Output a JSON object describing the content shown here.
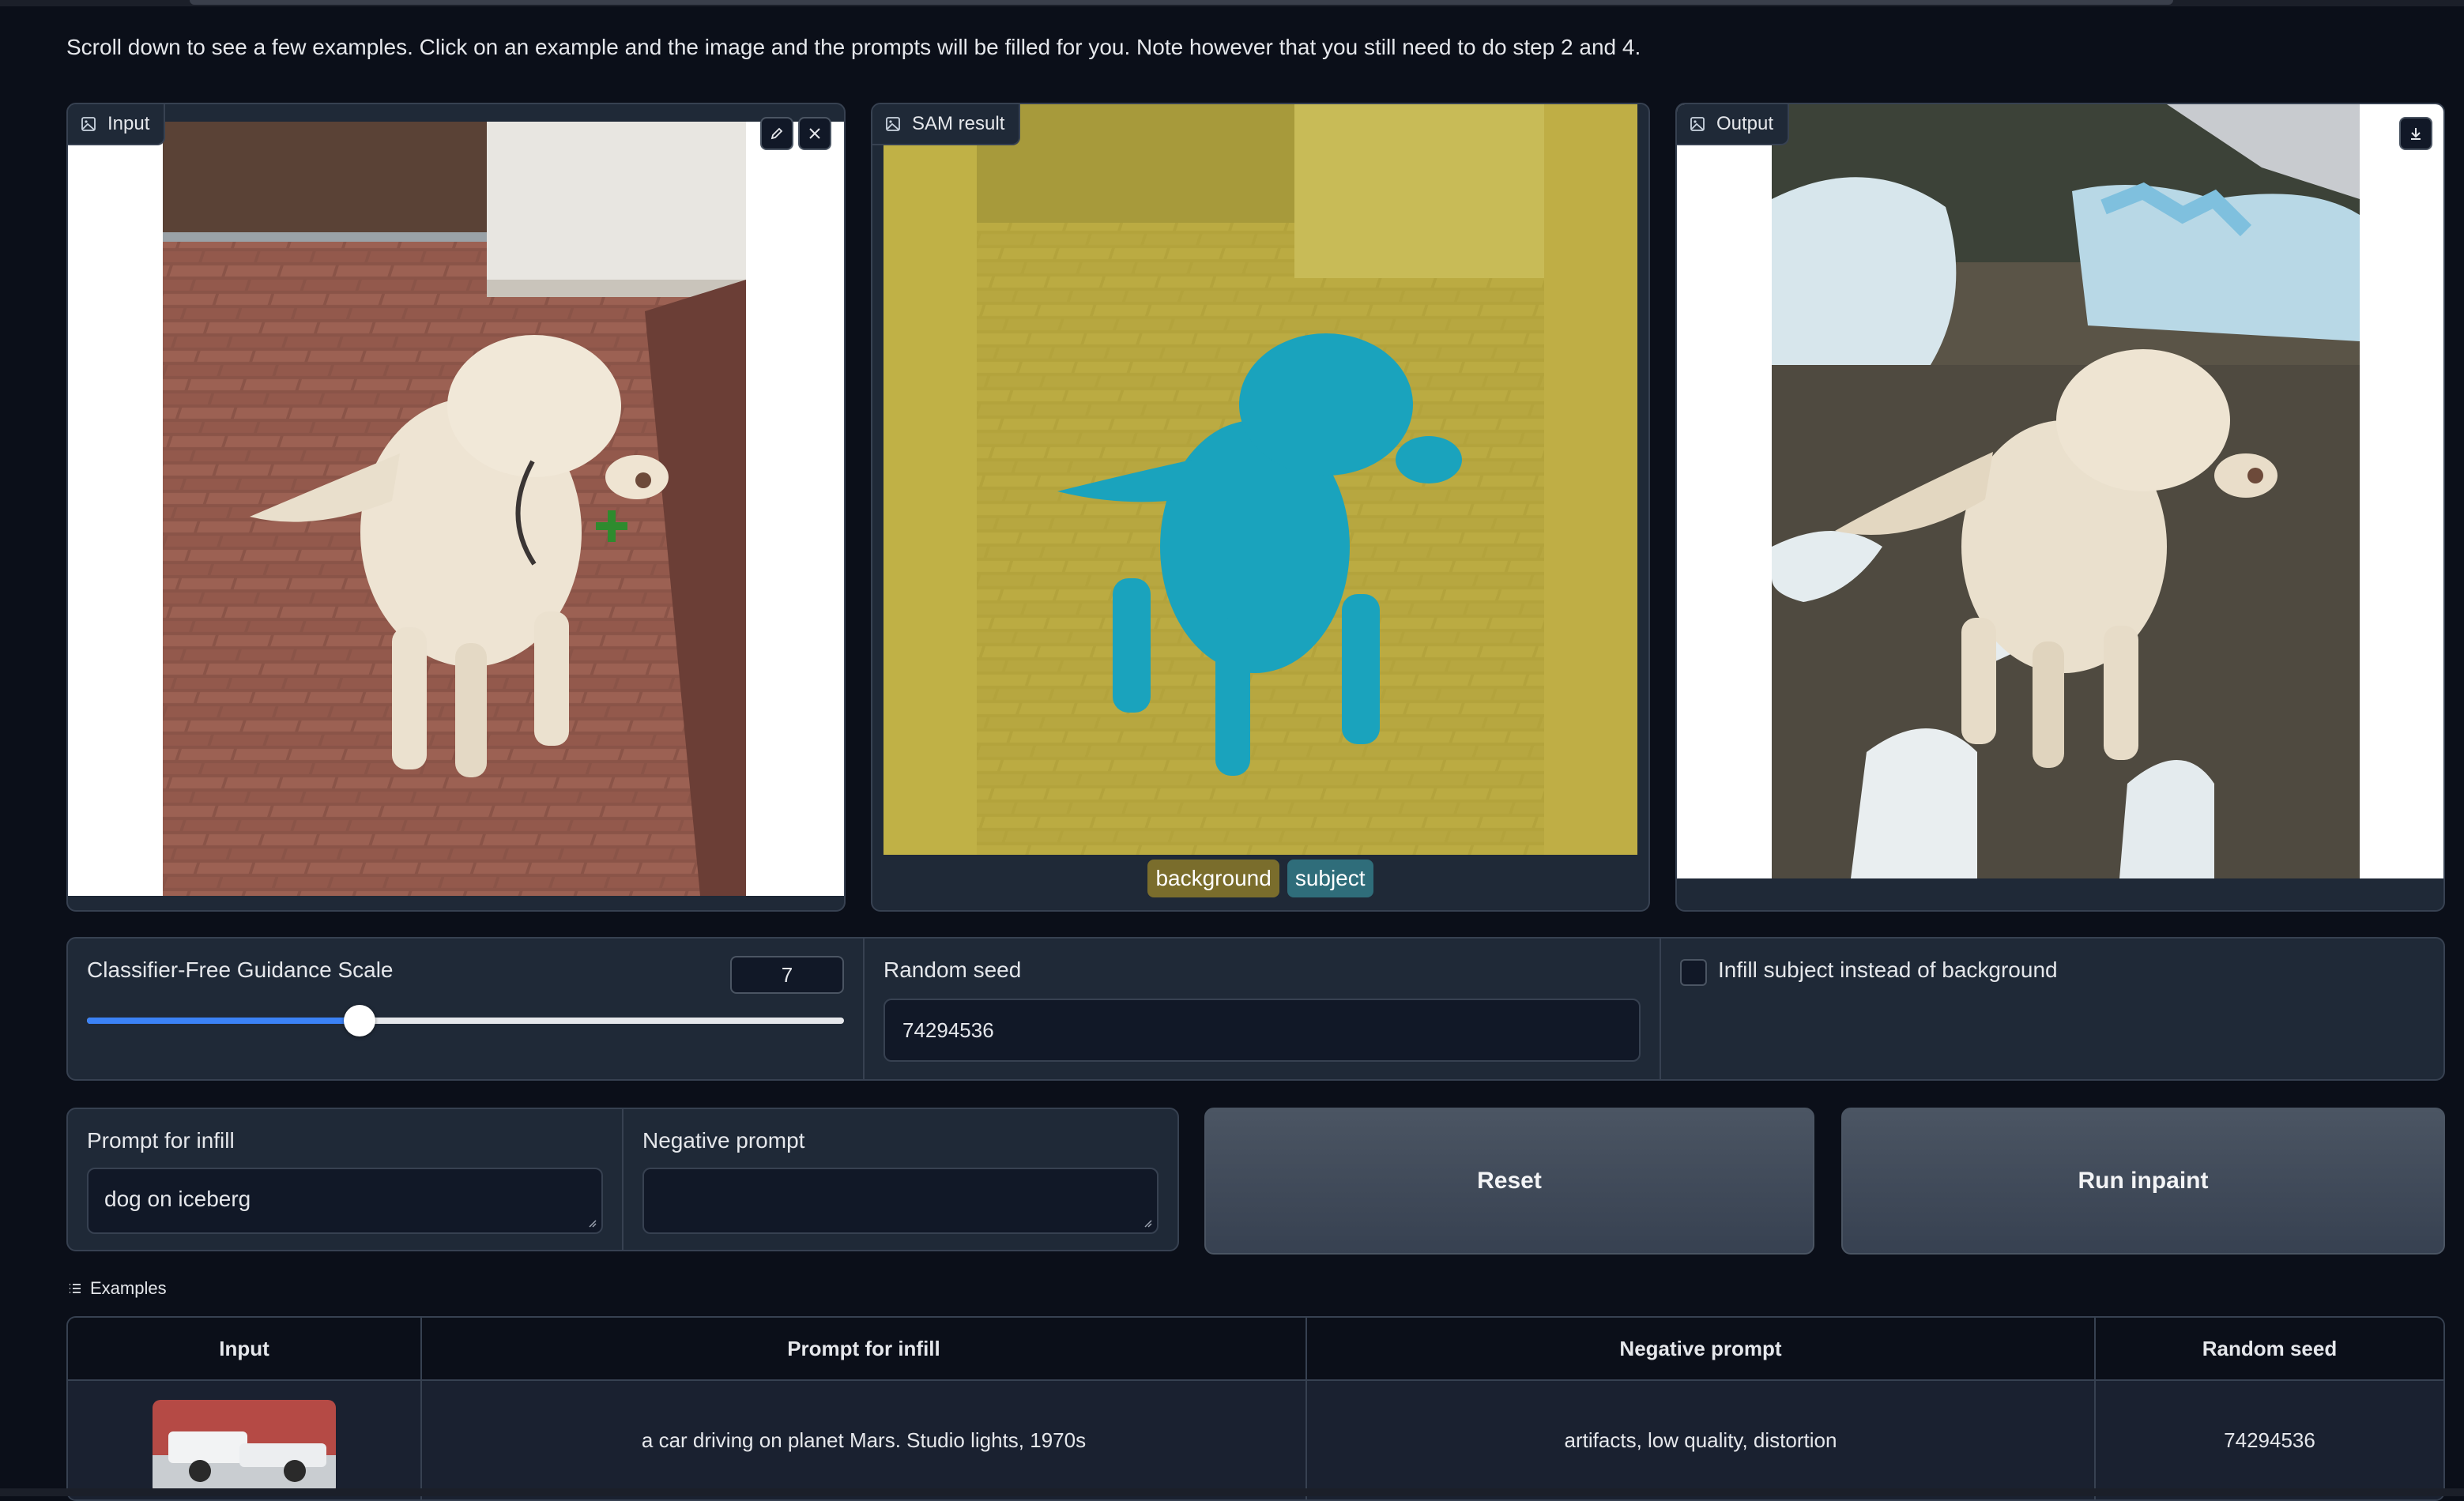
{
  "intro_text": "Scroll down to see a few examples. Click on an example and the image and the prompts will be filled for you. Note however that you still need to do step 2 and 4.",
  "panels": {
    "input": {
      "label": "Input",
      "icon": "image-icon"
    },
    "sam": {
      "label": "SAM result",
      "icon": "image-icon",
      "legend": [
        {
          "label": "background",
          "color": "#7a6d2c"
        },
        {
          "label": "subject",
          "color": "#2f6d7a"
        }
      ]
    },
    "output": {
      "label": "Output",
      "icon": "image-icon"
    }
  },
  "controls": {
    "cfg": {
      "label": "Classifier-Free Guidance Scale",
      "value": "7",
      "slider_fraction": 0.36
    },
    "seed": {
      "label": "Random seed",
      "value": "74294536"
    },
    "infill_subject": {
      "label": "Infill subject instead of background",
      "checked": false
    }
  },
  "prompts": {
    "prompt": {
      "label": "Prompt for infill",
      "value": "dog on iceberg"
    },
    "negative": {
      "label": "Negative prompt",
      "value": ""
    }
  },
  "buttons": {
    "reset": "Reset",
    "run": "Run inpaint"
  },
  "examples": {
    "title": "Examples",
    "headers": [
      "Input",
      "Prompt for infill",
      "Negative prompt",
      "Random seed"
    ],
    "rows": [
      {
        "prompt": "a car driving on planet Mars. Studio lights, 1970s",
        "negative": "artifacts, low quality, distortion",
        "seed": "74294536"
      }
    ]
  },
  "colors": {
    "accent": "#3b82f6",
    "mask_background": "#b9a93d",
    "mask_subject": "#1ea6c0"
  }
}
